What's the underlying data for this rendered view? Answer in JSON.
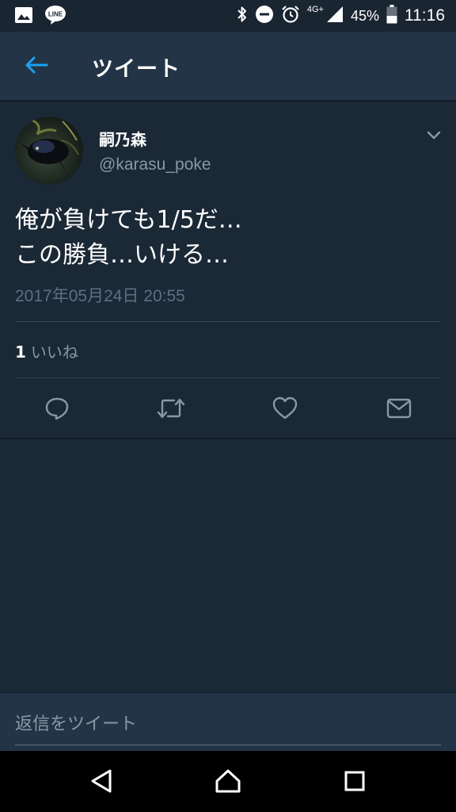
{
  "status_bar": {
    "icons_left": [
      "image-icon",
      "line-app-icon"
    ],
    "line_label": "LINE",
    "network": "4G+",
    "battery_percent": "45%",
    "time": "11:16",
    "battery_level": 0.45
  },
  "header": {
    "title": "ツイート"
  },
  "tweet": {
    "display_name": "嗣乃森",
    "handle": "@karasu_poke",
    "text_lines": [
      "俺が負けても1/5だ…",
      "この勝負…いける…"
    ],
    "timestamp": "2017年05月24日 20:55",
    "likes_count": "1",
    "likes_label": "いいね"
  },
  "actions": [
    "reply-icon",
    "retweet-icon",
    "like-icon",
    "direct-message-icon"
  ],
  "reply": {
    "placeholder": "返信をツイート"
  },
  "colors": {
    "background": "#1b2836",
    "app_bar": "#243447",
    "accent": "#1da1f2",
    "secondary_text": "#8899a6",
    "muted_text": "#5b7083"
  }
}
